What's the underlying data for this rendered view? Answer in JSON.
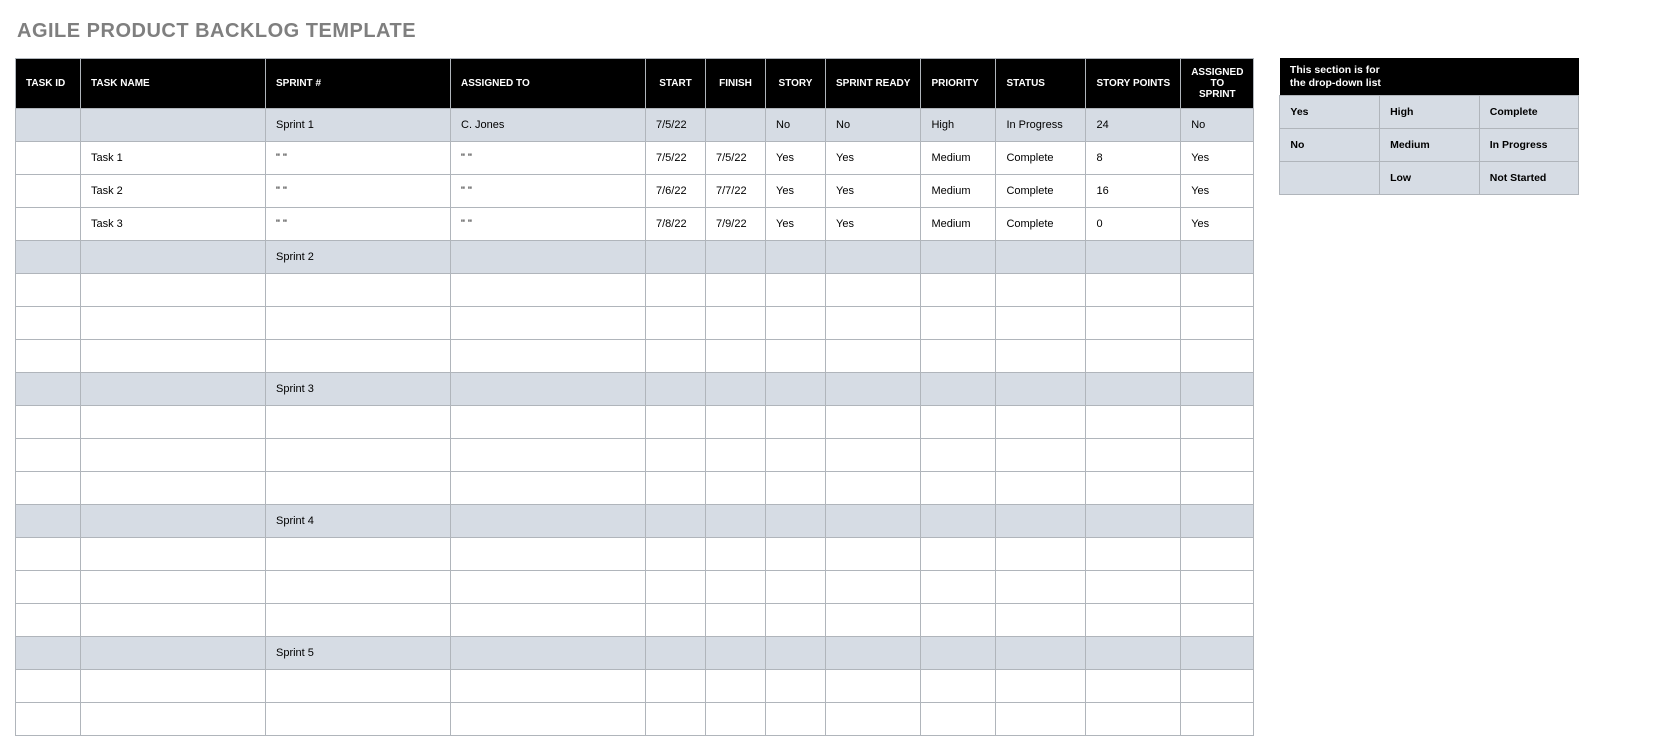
{
  "title": "AGILE PRODUCT BACKLOG TEMPLATE",
  "columns": {
    "task_id": "TASK ID",
    "task_name": "TASK NAME",
    "sprint": "SPRINT #",
    "assigned_to": "ASSIGNED TO",
    "start": "START",
    "finish": "FINISH",
    "story": "STORY",
    "sprint_ready": "SPRINT READY",
    "priority": "PRIORITY",
    "status": "STATUS",
    "story_points": "STORY POINTS",
    "assigned_to_sprint": "ASSIGNED TO SPRINT"
  },
  "rows": [
    {
      "type": "sprint",
      "task_id": "",
      "task_name": "",
      "sprint": "Sprint 1",
      "assigned_to": "C. Jones",
      "start": "7/5/22",
      "finish": "",
      "story": "No",
      "sprint_ready": "No",
      "priority": "High",
      "status": "In Progress",
      "story_points": "24",
      "assigned_to_sprint": "No"
    },
    {
      "type": "task",
      "task_id": "",
      "task_name": "Task 1",
      "sprint": "\" \"",
      "assigned_to": "\" \"",
      "start": "7/5/22",
      "finish": "7/5/22",
      "story": "Yes",
      "sprint_ready": "Yes",
      "priority": "Medium",
      "status": "Complete",
      "story_points": "8",
      "assigned_to_sprint": "Yes"
    },
    {
      "type": "task",
      "task_id": "",
      "task_name": "Task 2",
      "sprint": "\" \"",
      "assigned_to": "\" \"",
      "start": "7/6/22",
      "finish": "7/7/22",
      "story": "Yes",
      "sprint_ready": "Yes",
      "priority": "Medium",
      "status": "Complete",
      "story_points": "16",
      "assigned_to_sprint": "Yes"
    },
    {
      "type": "task",
      "task_id": "",
      "task_name": "Task 3",
      "sprint": "\" \"",
      "assigned_to": "\" \"",
      "start": "7/8/22",
      "finish": "7/9/22",
      "story": "Yes",
      "sprint_ready": "Yes",
      "priority": "Medium",
      "status": "Complete",
      "story_points": "0",
      "assigned_to_sprint": "Yes"
    },
    {
      "type": "sprint",
      "task_id": "",
      "task_name": "",
      "sprint": "Sprint 2",
      "assigned_to": "",
      "start": "",
      "finish": "",
      "story": "",
      "sprint_ready": "",
      "priority": "",
      "status": "",
      "story_points": "",
      "assigned_to_sprint": ""
    },
    {
      "type": "task"
    },
    {
      "type": "task"
    },
    {
      "type": "task"
    },
    {
      "type": "sprint",
      "task_id": "",
      "task_name": "",
      "sprint": "Sprint 3",
      "assigned_to": "",
      "start": "",
      "finish": "",
      "story": "",
      "sprint_ready": "",
      "priority": "",
      "status": "",
      "story_points": "",
      "assigned_to_sprint": ""
    },
    {
      "type": "task"
    },
    {
      "type": "task"
    },
    {
      "type": "task"
    },
    {
      "type": "sprint",
      "task_id": "",
      "task_name": "",
      "sprint": "Sprint 4",
      "assigned_to": "",
      "start": "",
      "finish": "",
      "story": "",
      "sprint_ready": "",
      "priority": "",
      "status": "",
      "story_points": "",
      "assigned_to_sprint": ""
    },
    {
      "type": "task"
    },
    {
      "type": "task"
    },
    {
      "type": "task"
    },
    {
      "type": "sprint",
      "task_id": "",
      "task_name": "",
      "sprint": "Sprint 5",
      "assigned_to": "",
      "start": "",
      "finish": "",
      "story": "",
      "sprint_ready": "",
      "priority": "",
      "status": "",
      "story_points": "",
      "assigned_to_sprint": ""
    },
    {
      "type": "task"
    },
    {
      "type": "task"
    }
  ],
  "dropdown": {
    "heading": "This section is for\nthe drop-down list",
    "grid": [
      [
        "Yes",
        "High",
        "Complete"
      ],
      [
        "No",
        "Medium",
        "In Progress"
      ],
      [
        "",
        "Low",
        "Not Started"
      ]
    ]
  }
}
